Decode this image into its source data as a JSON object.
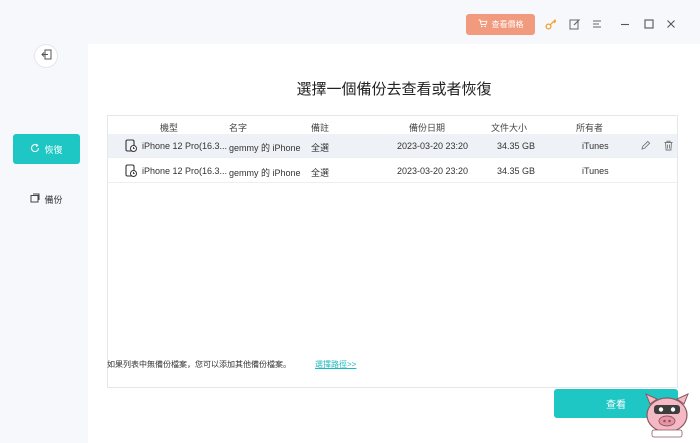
{
  "titlebar": {
    "buy_label": "查看價格",
    "icons": [
      "cart-icon",
      "key-icon",
      "edit-icon",
      "menu-icon",
      "minimize-icon",
      "maximize-icon",
      "close-icon"
    ]
  },
  "sidebar": {
    "items": [
      {
        "label": "恢復",
        "icon": "restore-icon",
        "active": true
      },
      {
        "label": "備份",
        "icon": "backup-icon",
        "active": false
      }
    ]
  },
  "main": {
    "heading": "選擇一個備份去查看或者恢復",
    "columns": [
      "機型",
      "名字",
      "備註",
      "備份日期",
      "文件大小",
      "所有者"
    ],
    "rows": [
      {
        "model": "iPhone 12 Pro(16.3...",
        "name": "gemmy 的 iPhone",
        "note": "全選",
        "date": "2023-03-20 23:20",
        "size": "34.35 GB",
        "owner": "iTunes"
      },
      {
        "model": "iPhone 12 Pro(16.3...",
        "name": "gemmy 的 iPhone",
        "note": "全選",
        "date": "2023-03-20 23:20",
        "size": "34.35 GB",
        "owner": "iTunes"
      }
    ],
    "footer_note": "如果列表中無備份檔案，您可以添加其他備份檔案。",
    "footer_link": "選擇路徑>>",
    "view_button": "查看"
  },
  "colors": {
    "accent": "#1ec7c4",
    "buy": "#f19a7e",
    "key": "#f0a030"
  }
}
